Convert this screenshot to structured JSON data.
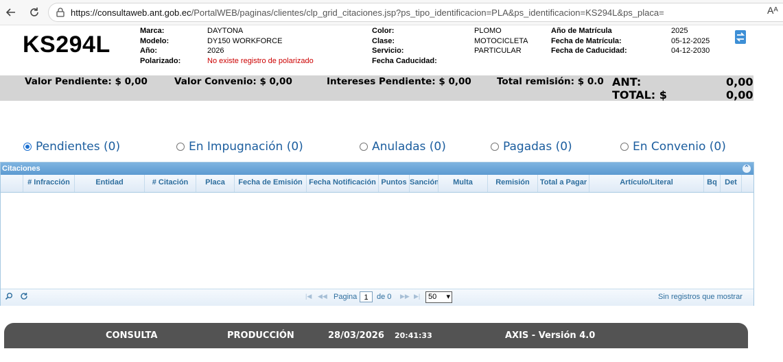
{
  "browser": {
    "url_host": "https://consultaweb.ant.gob.ec",
    "url_path": "/PortalWEB/paginas/clientes/clp_grid_citaciones.jsp?ps_tipo_identificacion=PLA&ps_identificacion=KS294L&ps_placa=",
    "reader_label": "Aᴬ"
  },
  "vehicle": {
    "plate": "KS294L",
    "col1": [
      {
        "label": "Marca:",
        "value": "DAYTONA"
      },
      {
        "label": "Modelo:",
        "value": "DY150 WORKFORCE"
      },
      {
        "label": "Año:",
        "value": "2026"
      },
      {
        "label": "Polarizado:",
        "value": "No existe registro de polarizado"
      }
    ],
    "col2": [
      {
        "label": "Color:",
        "value": "PLOMO"
      },
      {
        "label": "Clase:",
        "value": "MOTOCICLETA"
      },
      {
        "label": "Servicio:",
        "value": "PARTICULAR"
      },
      {
        "label": "Fecha Caducidad:",
        "value": ""
      }
    ],
    "col3": [
      {
        "label": "Año de Matrícula",
        "value": "2025"
      },
      {
        "label": "Fecha de Matrícula:",
        "value": "05-12-2025"
      },
      {
        "label": "Fecha de Caducidad:",
        "value": "04-12-2030"
      }
    ]
  },
  "summary": {
    "valor_pendiente": "Valor Pendiente: $  0,00",
    "valor_convenio": "Valor Convenio: $  0,00",
    "intereses": "Intereses Pendiente: $  0,00",
    "total_remision": "Total remisión: $ 0.0",
    "ant_label": "ANT:",
    "ant_value": "0,00",
    "total_label": "TOTAL: $",
    "total_value": "0,00"
  },
  "filters": [
    {
      "label": "Pendientes (0)",
      "selected": true
    },
    {
      "label": "En Impugnación (0)",
      "selected": false
    },
    {
      "label": "Anuladas (0)",
      "selected": false
    },
    {
      "label": "Pagadas (0)",
      "selected": false
    },
    {
      "label": "En Convenio (0)",
      "selected": false
    }
  ],
  "grid": {
    "title": "Citaciones",
    "columns": [
      "# Infracción",
      "Entidad",
      "# Citación",
      "Placa",
      "Fecha de Emisión",
      "Fecha Notificación",
      "Puntos",
      "Sanción",
      "Multa",
      "Remisión",
      "Total a Pagar",
      "Artículo/Literal",
      "Bq",
      "Det"
    ],
    "page_label": "Pagina",
    "page_value": "1",
    "of_label": "de 0",
    "page_size": "50",
    "empty_text": "Sin registros que mostrar"
  },
  "footer": {
    "mode": "CONSULTA",
    "env": "PRODUCCIÓN",
    "date": "28/03/2026",
    "time": "20:41:33",
    "version": "AXIS - Versión 4.0"
  }
}
